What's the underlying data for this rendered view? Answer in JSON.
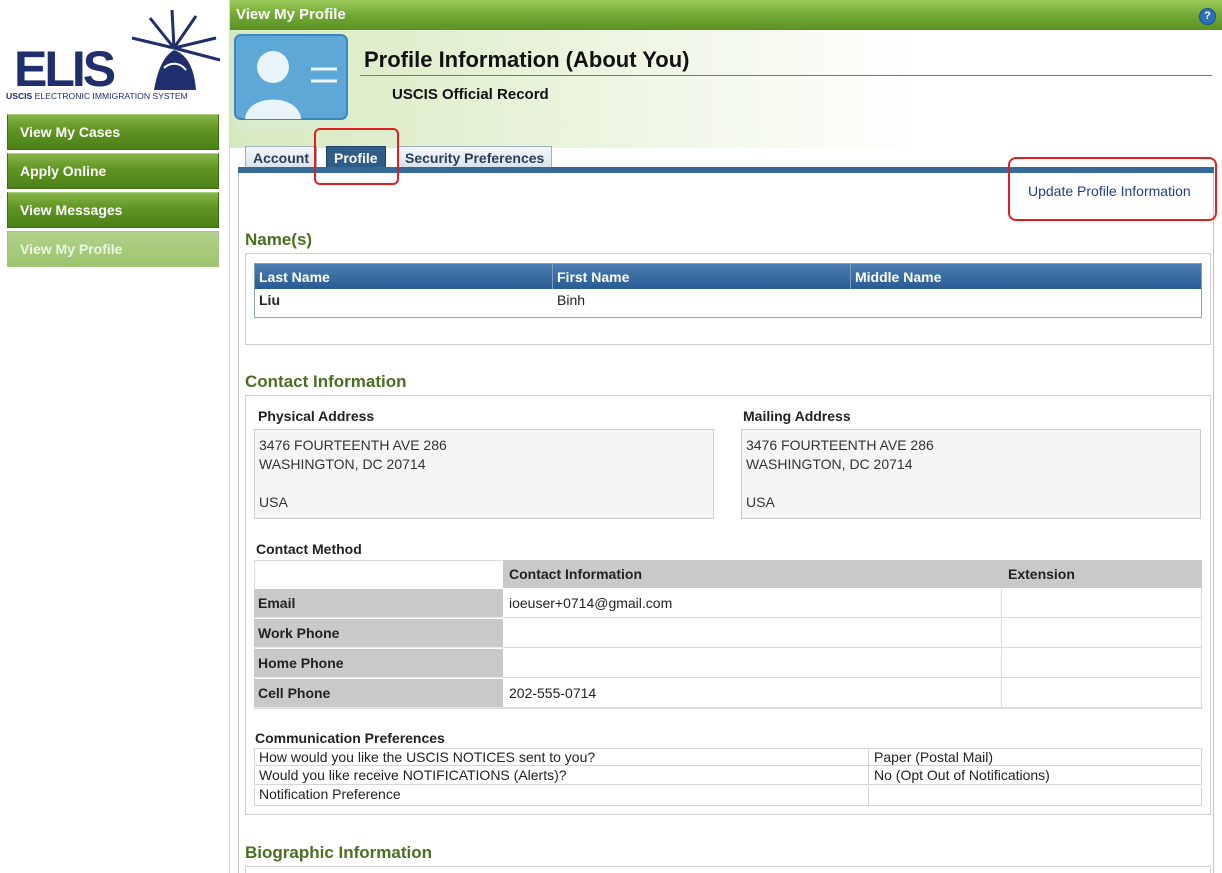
{
  "logo": {
    "text": "ELIS",
    "subtitle_bold": "USCIS",
    "subtitle_rest": " ELECTRONIC IMMIGRATION SYSTEM"
  },
  "nav": [
    {
      "label": "View My Cases"
    },
    {
      "label": "Apply Online"
    },
    {
      "label": "View Messages"
    },
    {
      "label": "View My Profile",
      "active": true
    }
  ],
  "header": {
    "bar_title": "View My Profile",
    "help": "?",
    "page_title": "Profile Information (About You)",
    "subtitle": "USCIS Official Record"
  },
  "tabs": [
    {
      "label": "Account"
    },
    {
      "label": "Profile",
      "active": true
    },
    {
      "label": "Security Preferences"
    }
  ],
  "update_link": "Update Profile Information",
  "names": {
    "heading": "Name(s)",
    "columns": [
      "Last Name",
      "First Name",
      "Middle Name"
    ],
    "row": [
      "Liu",
      "Binh",
      ""
    ]
  },
  "contact": {
    "heading": "Contact Information",
    "physical": {
      "label": "Physical Address",
      "line1": "3476 FOURTEENTH AVE 286",
      "line2": "WASHINGTON, DC 20714",
      "country": "USA"
    },
    "mailing": {
      "label": "Mailing Address",
      "line1": "3476 FOURTEENTH AVE 286",
      "line2": "WASHINGTON, DC 20714",
      "country": "USA"
    },
    "method_label": "Contact Method",
    "method_columns": [
      "Contact Information",
      "Extension"
    ],
    "methods": [
      {
        "label": "Email",
        "value": "ioeuser+0714@gmail.com",
        "ext": ""
      },
      {
        "label": "Work Phone",
        "value": "",
        "ext": ""
      },
      {
        "label": "Home Phone",
        "value": "",
        "ext": ""
      },
      {
        "label": "Cell Phone",
        "value": "202-555-0714",
        "ext": ""
      }
    ],
    "prefs_label": "Communication Preferences",
    "prefs": [
      {
        "q": "How would you like the USCIS NOTICES sent to you?",
        "a": "Paper (Postal Mail)"
      },
      {
        "q": "Would you like receive NOTIFICATIONS (Alerts)?",
        "a": "No (Opt Out of Notifications)"
      },
      {
        "q": "Notification Preference",
        "a": ""
      }
    ]
  },
  "biographic": {
    "heading": "Biographic Information"
  },
  "colors": {
    "nav_green": "#5f9423",
    "heading_green": "#4a6e22",
    "tab_blue": "#356a97",
    "highlight_red": "#e02020"
  }
}
